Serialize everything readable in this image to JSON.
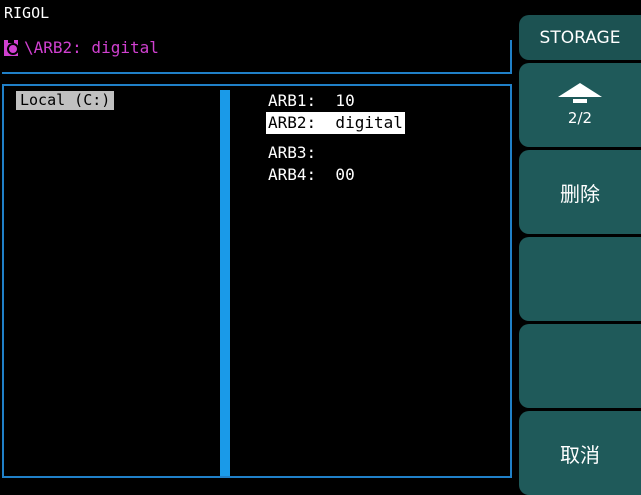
{
  "header": {
    "brand": "RIGOL",
    "path": "\\ARB2:  digital"
  },
  "browser": {
    "drive": "Local (C:)",
    "files": [
      {
        "label": "ARB1:  10",
        "selected": false
      },
      {
        "label": "ARB2:  digital",
        "selected": true
      },
      {
        "label": "ARB3:",
        "selected": false
      },
      {
        "label": "ARB4:  00",
        "selected": false
      }
    ]
  },
  "softkeys": {
    "title": "STORAGE",
    "page": "2/2",
    "key2": "删除",
    "key3": "",
    "key4": "",
    "key5": "取消"
  },
  "colors": {
    "background": "#000000",
    "accent_magenta": "#d040d0",
    "frame_blue": "#2080c8",
    "scrollbar_blue": "#1a9ae8",
    "softkey_teal": "#1f5a5a"
  }
}
